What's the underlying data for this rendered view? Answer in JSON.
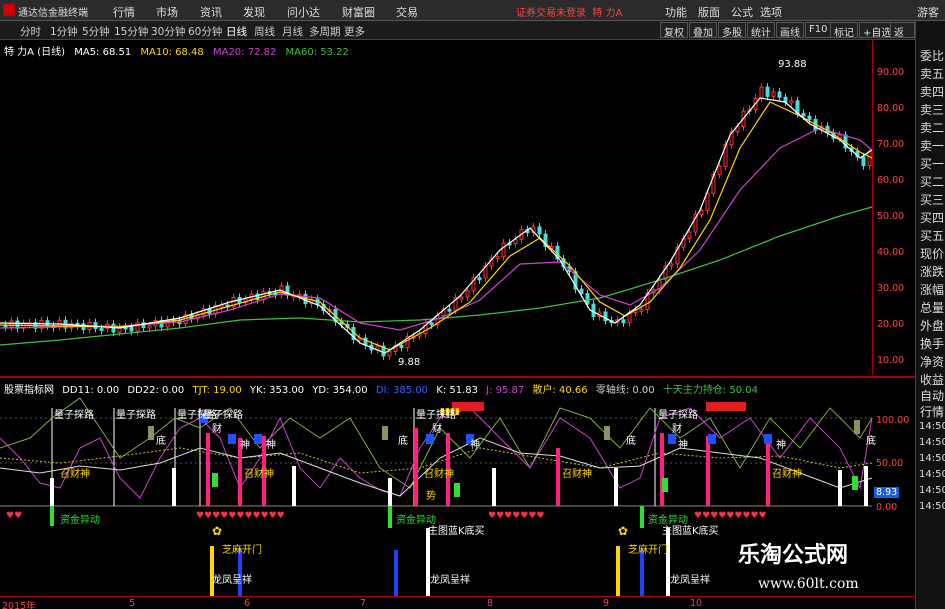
{
  "app": {
    "title": "通达信金融终端",
    "menus": [
      "行情",
      "市场",
      "资讯",
      "发现",
      "问小达",
      "财富圈",
      "交易"
    ],
    "notice": "证券交易未登录",
    "stock_name": "特 力A",
    "right_buttons": [
      "功能",
      "版面",
      "公式",
      "选项"
    ],
    "login": "游客"
  },
  "periods": [
    "分时",
    "1分钟",
    "5分钟",
    "15分钟",
    "30分钟",
    "60分钟",
    "日线",
    "周线",
    "月线",
    "多周期",
    "更多"
  ],
  "active_period": "日线",
  "tools": [
    "复权",
    "叠加",
    "多股",
    "统计",
    "画线",
    "F10",
    "标记",
    "+自选",
    "返回"
  ],
  "right_tabs": [
    "委比",
    "卖五",
    "卖四",
    "卖三",
    "卖二",
    "卖一",
    "买一",
    "买二",
    "买三",
    "买四",
    "买五",
    "现价",
    "涨跌",
    "涨幅",
    "总量",
    "外盘",
    "换手",
    "净资",
    "收益",
    "自动",
    "行情"
  ],
  "right_times": [
    "14:50",
    "14:50",
    "14:50",
    "14:50",
    "14:50",
    "14:50"
  ],
  "ma_legend": {
    "title": "特 力A (日线)",
    "items": [
      {
        "label": "MA5: 68.51",
        "color": "#ffffff"
      },
      {
        "label": "MA10: 68.48",
        "color": "#ffd700"
      },
      {
        "label": "MA20: 72.82",
        "color": "#d040d0"
      },
      {
        "label": "MA60: 53.22",
        "color": "#40c040"
      }
    ]
  },
  "price_ticks": [
    "90.00",
    "80.00",
    "70.00",
    "60.00",
    "50.00",
    "40.00",
    "30.00",
    "20.00",
    "10.00"
  ],
  "price_labels": {
    "high": "93.88",
    "low": "9.88"
  },
  "indicator_legend": {
    "title": "股票指标网",
    "items": [
      {
        "label": "DD11: 0.00",
        "color": "#ffffff"
      },
      {
        "label": "DD22: 0.00",
        "color": "#ffffff"
      },
      {
        "label": "TJT: 19.00",
        "color": "#ffd700"
      },
      {
        "label": "YK: 353.00",
        "color": "#ffffff"
      },
      {
        "label": "YD: 354.00",
        "color": "#ffffff"
      },
      {
        "label": "DI: 385.00",
        "color": "#3060ff"
      },
      {
        "label": "K: 51.83",
        "color": "#ffffff"
      },
      {
        "label": "J: 95.87",
        "color": "#d040d0"
      },
      {
        "label": "散户: 40.66",
        "color": "#ffd700"
      },
      {
        "label": "零轴线: 0.00",
        "color": "#d0d0d0"
      },
      {
        "label": "十天主力持仓: 50.04",
        "color": "#40c040"
      }
    ]
  },
  "ind_ticks": [
    "100.00",
    "50.00",
    "0.00"
  ],
  "ind_badge": "8.93",
  "signals": {
    "tanlu": "量子探路",
    "di": "底",
    "cai": "财",
    "shen": "神",
    "zhao": "召财神",
    "zijin": "资金异动",
    "zhutu": "主图蓝K底买",
    "zhima": "芝麻开门",
    "longfeng": "龙凤呈祥",
    "shi": "势"
  },
  "dates": [
    "2015年",
    "5",
    "6",
    "7",
    "8",
    "9",
    "10"
  ],
  "watermark": {
    "title": "乐淘公式网",
    "url": "www.60lt.com"
  }
}
